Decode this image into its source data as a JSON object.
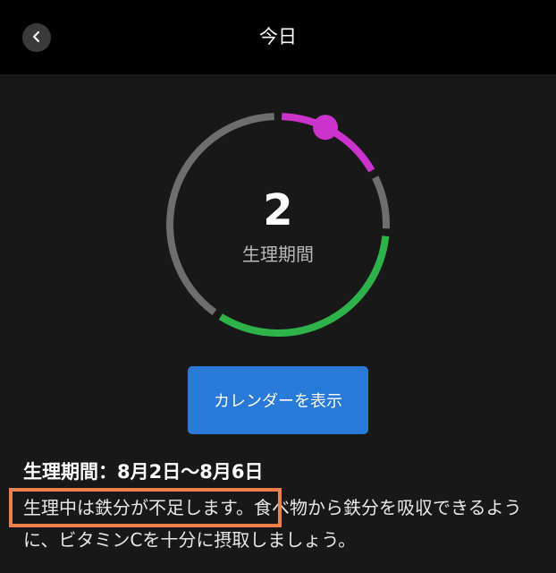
{
  "header": {
    "title": "今日",
    "back_icon": "chevron-left-icon"
  },
  "cycle": {
    "day": "2",
    "phase_label": "生理期間"
  },
  "colors": {
    "period": "#cc33cc",
    "fertile": "#2db34a",
    "neutral": "#6e6e6e",
    "button": "#2979d8",
    "highlight": "#f07f4a"
  },
  "calendar_button": {
    "label": "カレンダーを表示"
  },
  "info": {
    "period_title": "生理期間：8月2日〜8月6日",
    "advice": "生理中は鉄分が不足します。食べ物から鉄分を吸収できるように、ビタミンCを十分に摂取しましょう。"
  }
}
